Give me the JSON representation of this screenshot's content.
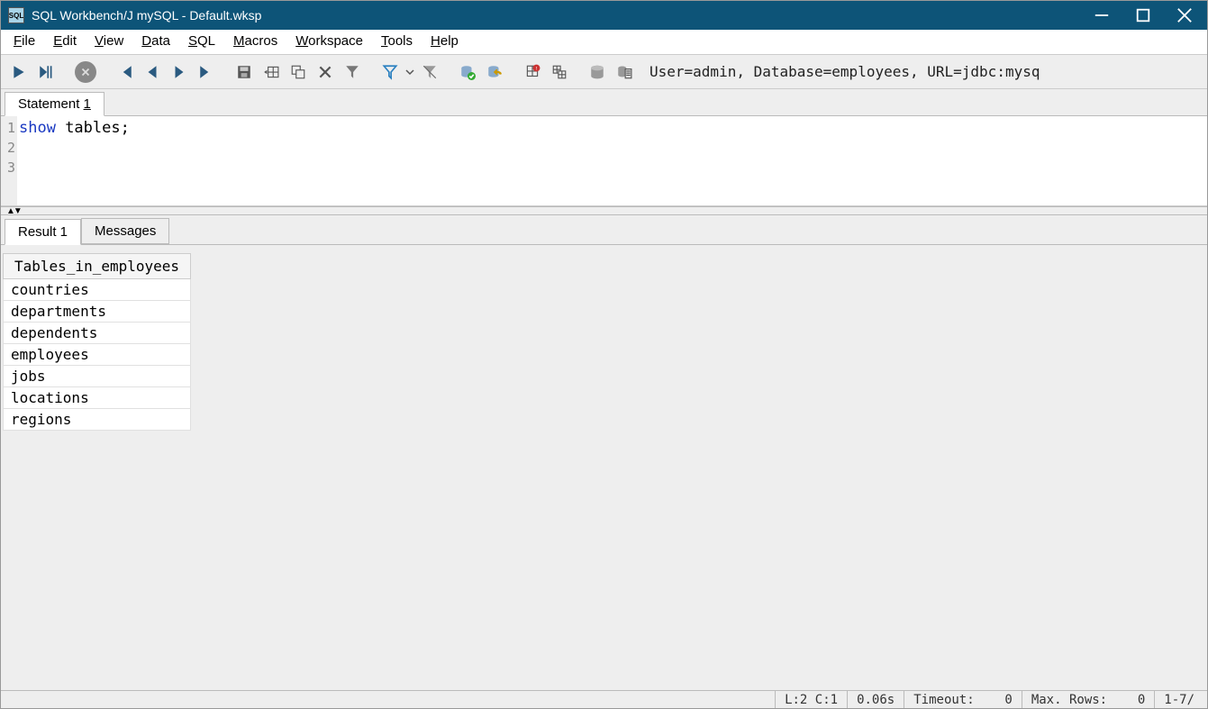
{
  "title": "SQL Workbench/J mySQL - Default.wksp",
  "menubar": [
    {
      "label": "File",
      "accel": "F"
    },
    {
      "label": "Edit",
      "accel": "E"
    },
    {
      "label": "View",
      "accel": "V"
    },
    {
      "label": "Data",
      "accel": "D"
    },
    {
      "label": "SQL",
      "accel": "S"
    },
    {
      "label": "Macros",
      "accel": "M"
    },
    {
      "label": "Workspace",
      "accel": "W"
    },
    {
      "label": "Tools",
      "accel": "T"
    },
    {
      "label": "Help",
      "accel": "H"
    }
  ],
  "connection_info": "User=admin, Database=employees, URL=jdbc:mysq",
  "statement_tab": {
    "label": "Statement ",
    "num": "1"
  },
  "editor": {
    "lines": [
      "1",
      "2",
      "3"
    ],
    "code_html": [
      "<span class='kw'>show</span> tables;",
      "",
      ""
    ]
  },
  "result_tabs": [
    {
      "label": "Result 1",
      "active": true
    },
    {
      "label": "Messages",
      "active": false
    }
  ],
  "result": {
    "header": "Tables_in_employees",
    "rows": [
      "countries",
      "departments",
      "dependents",
      "employees",
      "jobs",
      "locations",
      "regions"
    ]
  },
  "statusbar": {
    "pos": "L:2 C:1",
    "time": "0.06s",
    "timeout_label": "Timeout:",
    "timeout_val": "0",
    "maxrows_label": "Max. Rows:",
    "maxrows_val": "0",
    "range": "1-7/"
  }
}
